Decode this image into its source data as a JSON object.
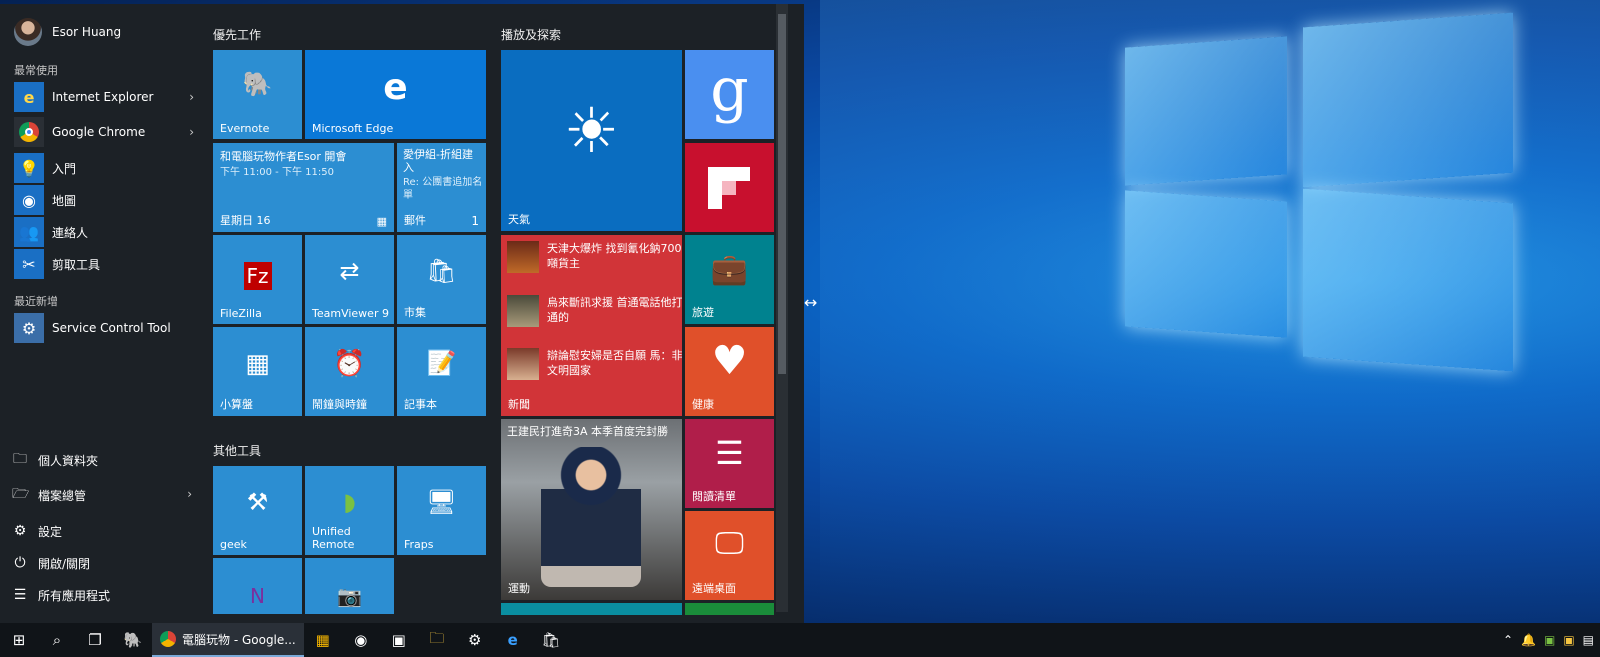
{
  "user": {
    "name": "Esor Huang"
  },
  "sections": {
    "most_used": "最常使用",
    "recent": "最近新增"
  },
  "most_used": [
    {
      "label": "Internet Explorer",
      "icon": "internet-explorer-icon"
    },
    {
      "label": "Google Chrome",
      "icon": "chrome-icon"
    },
    {
      "label": "入門",
      "icon": "lightbulb-icon"
    },
    {
      "label": "地圖",
      "icon": "maps-icon"
    },
    {
      "label": "連絡人",
      "icon": "people-icon"
    },
    {
      "label": "剪取工具",
      "icon": "snipping-tool-icon"
    }
  ],
  "recent": [
    {
      "label": "Service Control Tool",
      "icon": "service-control-icon"
    }
  ],
  "system": [
    {
      "label": "個人資料夾",
      "icon": "user-folder-icon"
    },
    {
      "label": "檔案總管",
      "icon": "file-explorer-icon"
    },
    {
      "label": "設定",
      "icon": "gear-icon"
    },
    {
      "label": "開啟/關閉",
      "icon": "power-icon"
    },
    {
      "label": "所有應用程式",
      "icon": "all-apps-icon"
    }
  ],
  "groups": {
    "g1": "優先工作",
    "g2": "播放及探索",
    "g3": "其他工具"
  },
  "tiles": {
    "evernote": "Evernote",
    "edge": "Microsoft Edge",
    "calendar": {
      "title": "和電腦玩物作者Esor 開會",
      "time": "下午 11:00 - 下午 11:50",
      "day": "星期日 16"
    },
    "mail": {
      "title": "愛伊組-折組建入",
      "body": "Re: 公團書追加名單",
      "label": "郵件",
      "count": "1"
    },
    "filezilla": "FileZilla",
    "teamviewer": "TeamViewer 9",
    "store": "市集",
    "calculator": "小算盤",
    "alarms": "鬧鐘與時鐘",
    "notepad": "記事本",
    "geek": "geek",
    "unified": "Unified Remote",
    "fraps": "Fraps",
    "weather": "天氣",
    "travel": "旅遊",
    "health": "健康",
    "reading": "閱讀清單",
    "remote": "遠端桌面",
    "news": {
      "label": "新聞",
      "items": [
        "天津大爆炸 找到氰化鈉700噸貨主",
        "烏來斷訊求援 首通電話他打通的",
        "辯論慰安婦是否自願 馬：非文明國家"
      ]
    },
    "sports": {
      "headline": "王建民打進奇3A 本季首度完封勝",
      "label": "運動"
    }
  },
  "taskbar": {
    "active_app": "電腦玩物 - Google..."
  },
  "colors": {
    "accent": "#2c8ed2",
    "menu_bg": "#1c2126",
    "news": "#d13438",
    "flipboard": "#c8102e",
    "travel": "#00828f",
    "health": "#e0502a",
    "reading": "#b01e4a"
  }
}
